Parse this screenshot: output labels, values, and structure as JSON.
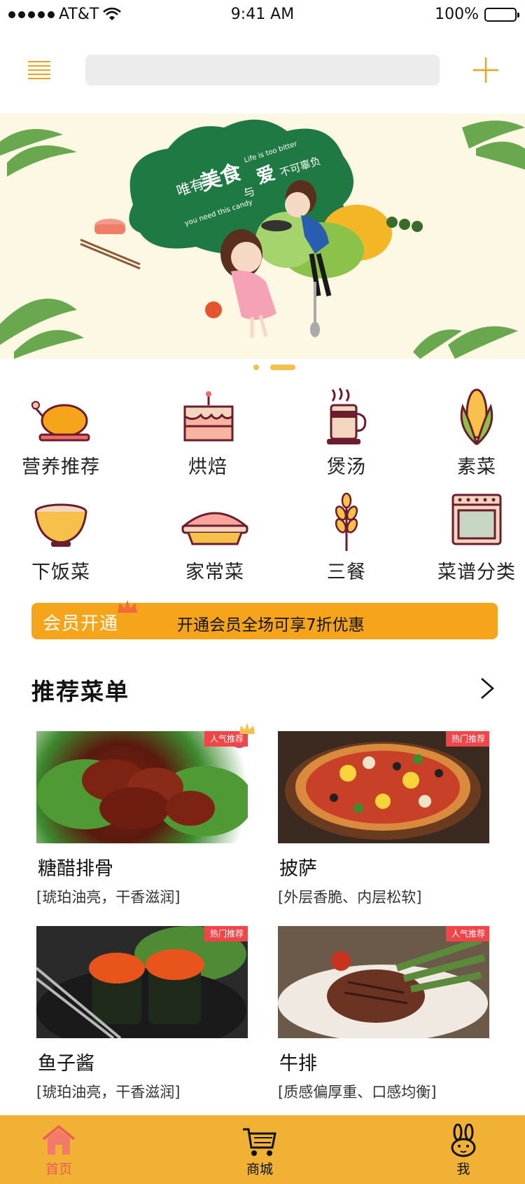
{
  "status_bar": {
    "carrier": "AT&T",
    "time": "9:41 AM",
    "battery": "100%"
  },
  "header": {
    "search_placeholder": ""
  },
  "banner": {
    "headline_small": "唯有",
    "headline_big": "美食",
    "headline_and": "与",
    "headline_love": "爱",
    "headline_end": "不可辜负",
    "en_line1": "Life is too bitter",
    "en_line2": "you need this candy"
  },
  "categories": [
    {
      "label": "营养推荐",
      "icon": "roast-chicken-icon"
    },
    {
      "label": "烘焙",
      "icon": "cake-icon"
    },
    {
      "label": "煲汤",
      "icon": "soup-cup-icon"
    },
    {
      "label": "素菜",
      "icon": "corn-icon"
    },
    {
      "label": "下饭菜",
      "icon": "bowl-icon"
    },
    {
      "label": "家常菜",
      "icon": "pie-icon"
    },
    {
      "label": "三餐",
      "icon": "wheat-icon"
    },
    {
      "label": "菜谱分类",
      "icon": "oven-icon"
    }
  ],
  "member": {
    "title": "会员开通",
    "desc": "开通会员全场可享7折优惠"
  },
  "section": {
    "title": "推荐菜单"
  },
  "recipes": [
    {
      "name": "糖醋排骨",
      "desc": "[琥珀油亮，干香滋润]",
      "tag": "人气推荐"
    },
    {
      "name": "披萨",
      "desc": "[外层香脆、内层松软]",
      "tag": "热门推荐"
    },
    {
      "name": "鱼子酱",
      "desc": "[琥珀油亮，干香滋润]",
      "tag": "热门推荐"
    },
    {
      "name": "牛排",
      "desc": "[质感偏厚重、口感均衡]",
      "tag": "人气推荐"
    }
  ],
  "tabs": [
    {
      "label": "首页",
      "icon": "home-icon",
      "active": true
    },
    {
      "label": "商城",
      "icon": "cart-icon",
      "active": false
    },
    {
      "label": "我",
      "icon": "rabbit-icon",
      "active": false
    }
  ],
  "colors": {
    "accent": "#f1b134",
    "member": "#f6a51b",
    "tag": "#f0464a",
    "active_tab": "#f05a5a",
    "icon_stroke": "#6b1d2e"
  }
}
